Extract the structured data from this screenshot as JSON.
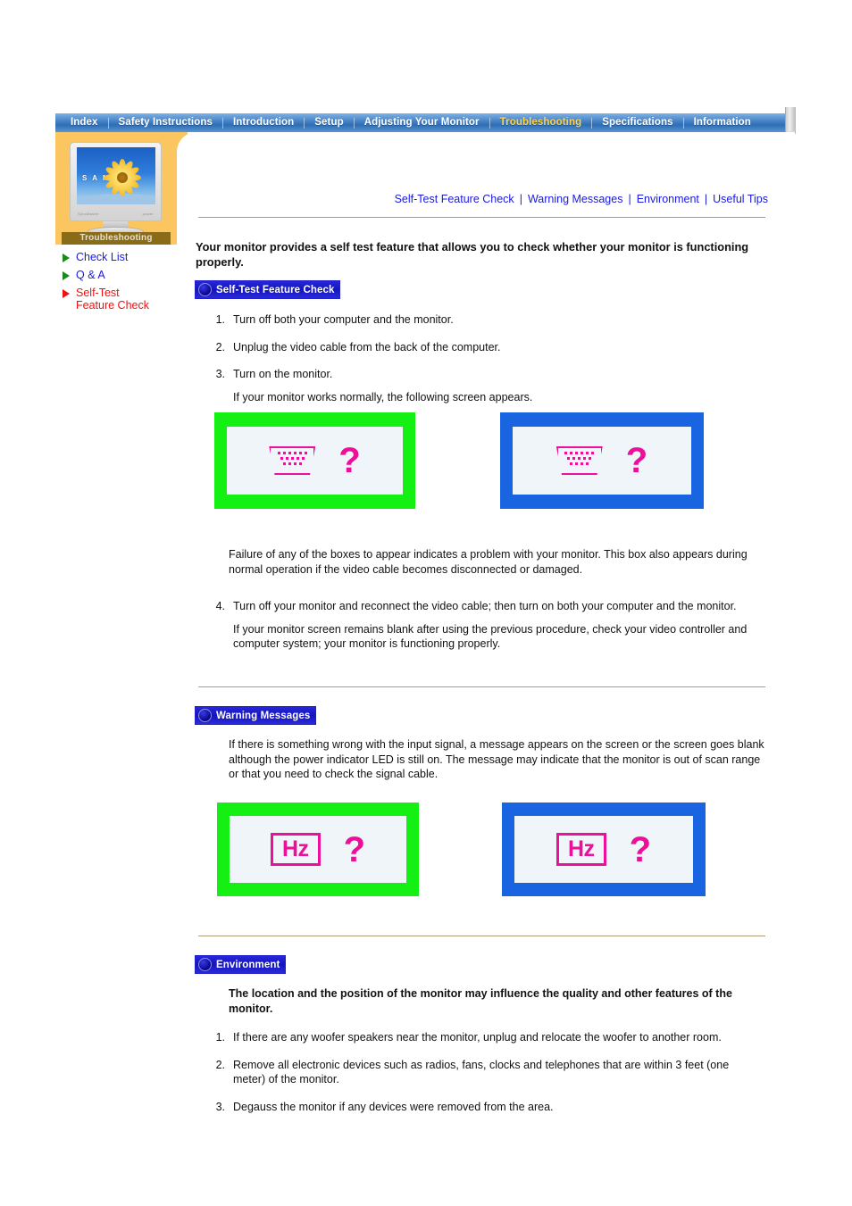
{
  "nav": {
    "items": [
      {
        "label": "Index",
        "active": false
      },
      {
        "label": "Safety Instructions",
        "active": false
      },
      {
        "label": "Introduction",
        "active": false
      },
      {
        "label": "Setup",
        "active": false
      },
      {
        "label": "Adjusting Your Monitor",
        "active": false
      },
      {
        "label": "Troubleshooting",
        "active": true
      },
      {
        "label": "Specifications",
        "active": false
      },
      {
        "label": "Information",
        "active": false
      }
    ],
    "active_color": "#ffd24a"
  },
  "sidebar": {
    "thumbnail": {
      "brand_text": "S A M",
      "caption": "Troubleshooting",
      "bezel_left": "SyncMaster",
      "bezel_right": "power"
    },
    "items": [
      {
        "label": "Check List",
        "color": "#1a1ae0",
        "marker": "green-triangle-icon"
      },
      {
        "label": "Q & A",
        "color": "#1a1ae0",
        "marker": "green-triangle-icon"
      },
      {
        "label": "Self-Test\nFeature Check",
        "color": "#ee1111",
        "marker": "red-triangle-icon"
      }
    ]
  },
  "sublinks": [
    {
      "label": "Self-Test Feature Check"
    },
    {
      "label": "Warning Messages"
    },
    {
      "label": "Environment"
    },
    {
      "label": "Useful Tips"
    }
  ],
  "sublink_separator": "|",
  "intro": "Your monitor provides a self test feature that allows you to check whether your monitor is functioning properly.",
  "sections": {
    "self_test": {
      "badge": "Self-Test Feature Check",
      "steps": [
        {
          "num": "1.",
          "text": "Turn off both your computer and the monitor."
        },
        {
          "num": "2.",
          "text": "Unplug the video cable from the back of the computer."
        },
        {
          "num": "3.",
          "text": "Turn on the monitor.",
          "sub": "If your monitor works normally, the following screen appears."
        }
      ],
      "after_boxes_para": "Failure of any of the boxes to appear indicates a problem with your monitor. This box also appears during normal operation if the video cable becomes disconnected or damaged.",
      "step4": {
        "num": "4.",
        "text": "Turn off your monitor and reconnect the video cable; then turn on both your computer and the monitor.",
        "sub": "If your monitor screen remains blank after using the previous procedure, check your video controller and computer system; your monitor is functioning properly."
      },
      "boxes": [
        {
          "name": "vga-connector-box-green",
          "frame_color": "#14ef14",
          "icon": "vga-connector-icon",
          "symbol": "?"
        },
        {
          "name": "vga-connector-box-blue",
          "frame_color": "#1964e0",
          "icon": "vga-connector-icon",
          "symbol": "?"
        }
      ]
    },
    "warning_messages": {
      "badge": "Warning Messages",
      "para": "If there is something wrong with the input signal, a message appears on the screen or the screen goes blank although the power indicator LED is still on. The message may indicate that the monitor is out of scan range or that you need to check the signal cable.",
      "boxes": [
        {
          "name": "hz-box-green",
          "frame_color": "#14ef14",
          "label": "Hz",
          "symbol": "?"
        },
        {
          "name": "hz-box-blue",
          "frame_color": "#1964e0",
          "label": "Hz",
          "symbol": "?"
        }
      ]
    },
    "environment": {
      "badge": "Environment",
      "lead": "The location and the position of the monitor may influence the quality and other features of the monitor.",
      "steps": [
        {
          "num": "1.",
          "text": "If there are any woofer speakers near the monitor, unplug and relocate the woofer to another room."
        },
        {
          "num": "2.",
          "text": "Remove all electronic devices such as radios, fans, clocks and telephones that are within 3 feet (one meter) of the monitor."
        },
        {
          "num": "3.",
          "text": "Degauss the monitor if any devices were removed from the area."
        }
      ]
    }
  }
}
